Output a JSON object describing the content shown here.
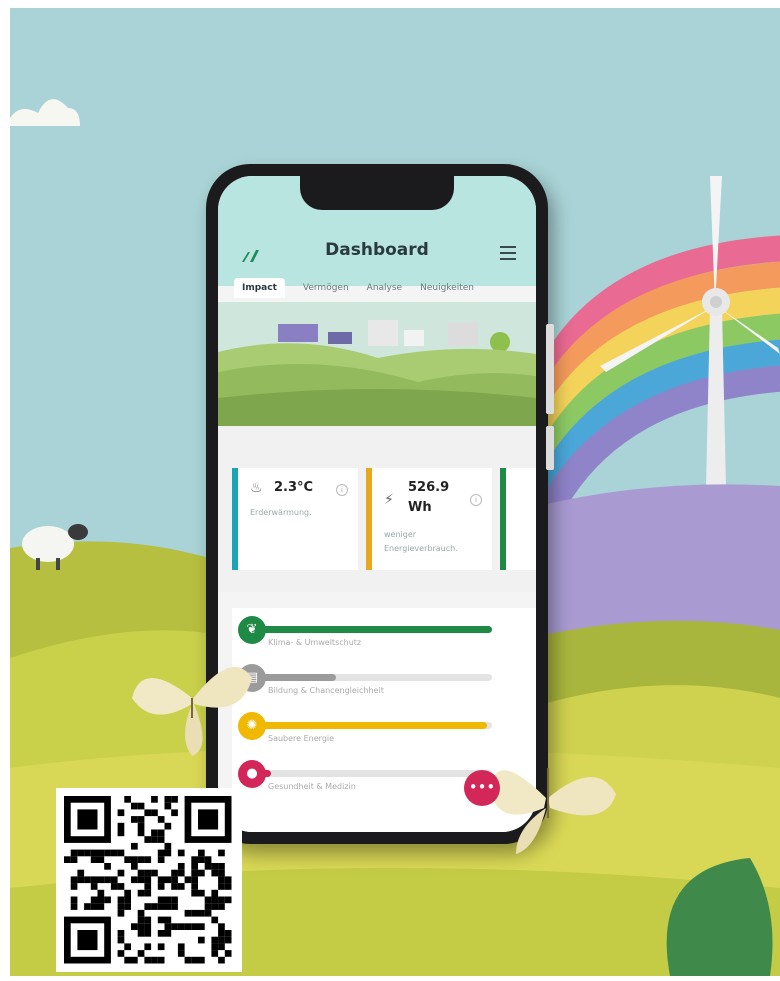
{
  "app": {
    "title": "Dashboard",
    "logo_icon": "wave-logo-icon",
    "tabs": [
      {
        "label": "Impact",
        "active": true
      },
      {
        "label": "Vermögen",
        "active": false
      },
      {
        "label": "Analyse",
        "active": false
      },
      {
        "label": "Neuigkeiten",
        "active": false
      }
    ]
  },
  "metrics": [
    {
      "value": "2.3°C",
      "label": "Erderwärmung.",
      "accent": "#1ba3b8",
      "icon": "thermometer-icon"
    },
    {
      "value": "526.9",
      "value2": "Wh",
      "label": "weniger",
      "label2": "Energieverbrauch.",
      "accent": "#e7a81e",
      "icon": "energy-icon"
    }
  ],
  "goals": [
    {
      "label": "Klima- & Umweltschutz",
      "progress": 1.0,
      "color": "#1e8a46",
      "icon": "leaf-icon"
    },
    {
      "label": "Bildung & Chancengleichheit",
      "progress": 0.32,
      "color": "#9b9b9b",
      "icon": "book-icon"
    },
    {
      "label": "Saubere Energie",
      "progress": 0.98,
      "color": "#f0b800",
      "icon": "bulb-icon"
    },
    {
      "label": "Gesundheit & Medizin",
      "progress": 0.02,
      "color": "#d3275a",
      "icon": "apple-icon"
    }
  ],
  "more_button": "•••",
  "colors": {
    "header": "#b9e5e0",
    "sky": "#a9d3d6"
  }
}
